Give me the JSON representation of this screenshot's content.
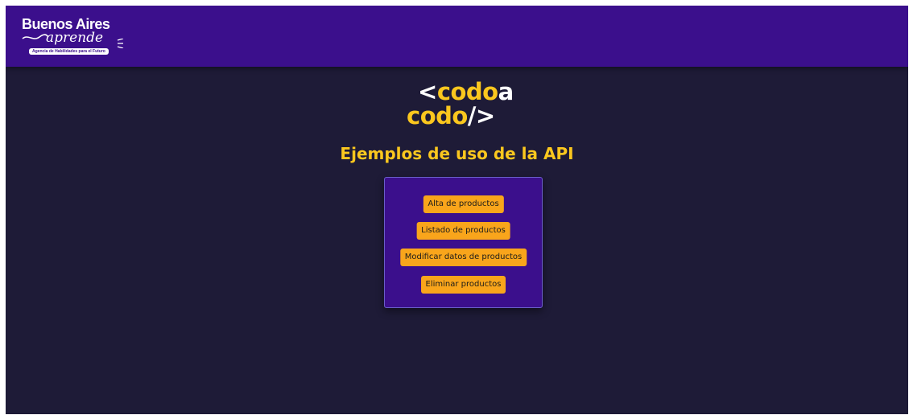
{
  "header": {
    "logo": {
      "line1": "Buenos Aires",
      "line2": "aprende",
      "tagline": "Agencia de Habilidades para el Futuro"
    }
  },
  "brand": {
    "part1": "<",
    "part2": "codo",
    "part3": "a",
    "part4": "codo",
    "part5": "/>"
  },
  "main": {
    "title": "Ejemplos de uso de la API",
    "buttons": [
      {
        "label": "Alta de productos"
      },
      {
        "label": "Listado de productos"
      },
      {
        "label": "Modificar datos de productos"
      },
      {
        "label": "Eliminar productos"
      }
    ]
  },
  "colors": {
    "header_bg": "#3b0f8c",
    "page_bg": "#1e1b37",
    "accent_yellow": "#fbc71e",
    "button_bg": "#f9a51b"
  }
}
